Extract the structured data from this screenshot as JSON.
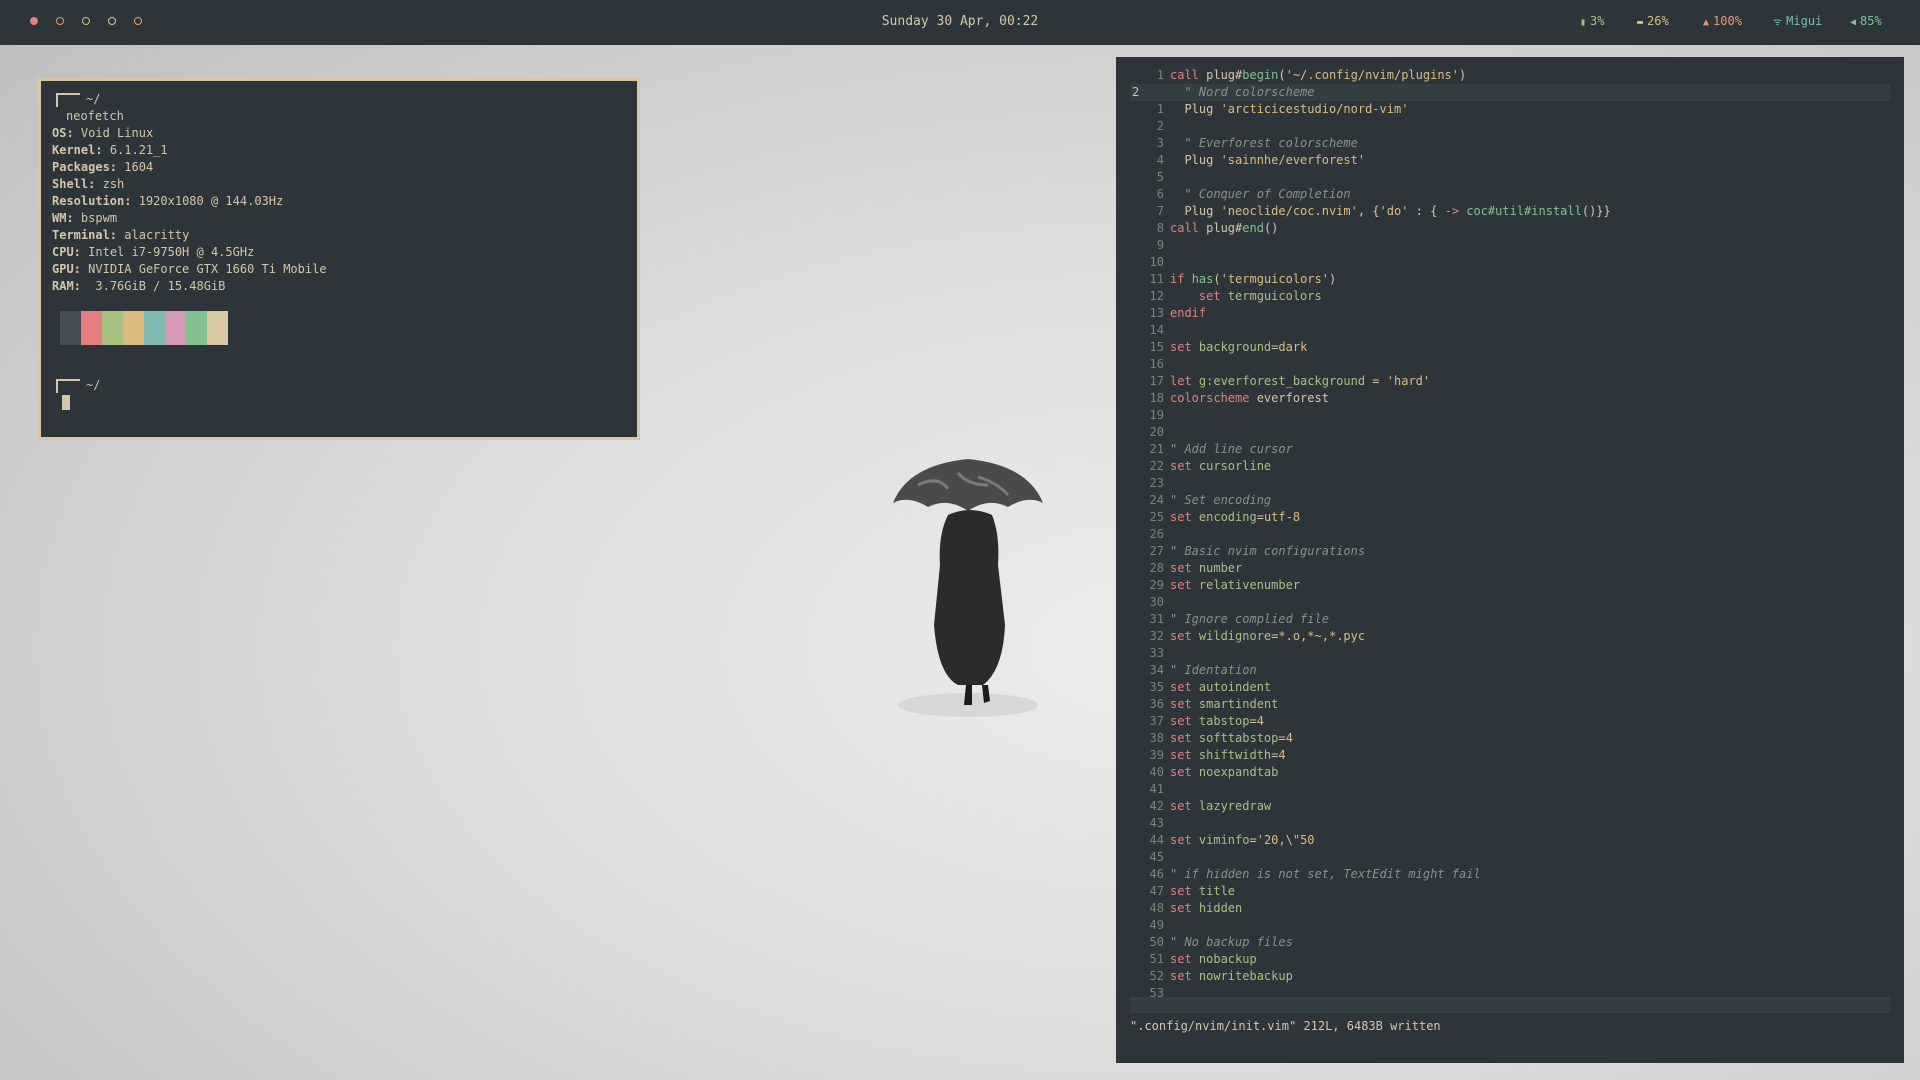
{
  "topbar": {
    "clock": "Sunday 30 Apr, 00:22",
    "cpu": "3%",
    "memory": "26%",
    "brightness": "100%",
    "network": "Migui",
    "volume": "85%"
  },
  "neofetch": {
    "prompt_dir": "~/",
    "command": "neofetch",
    "os_label": "OS:",
    "os_value": "Void Linux",
    "kernel_label": "Kernel:",
    "kernel_value": "6.1.21_1",
    "packages_label": "Packages:",
    "packages_value": "1604",
    "shell_label": "Shell:",
    "shell_value": "zsh",
    "resolution_label": "Resolution:",
    "resolution_value": "1920x1080 @ 144.03Hz",
    "wm_label": "WM:",
    "wm_value": "bspwm",
    "terminal_label": "Terminal:",
    "terminal_value": "alacritty",
    "cpu_label": "CPU:",
    "cpu_value": "Intel i7-9750H @ 4.5GHz",
    "gpu_label": "GPU:",
    "gpu_value": "NVIDIA GeForce GTX 1660 Ti Mobile",
    "ram_label": "RAM:",
    "ram_value": " 3.76GiB / 15.48GiB",
    "prompt_dir2": "~/",
    "palette": [
      "#434f55",
      "#e67e80",
      "#a7c080",
      "#dbbc7f",
      "#7fbbb3",
      "#d699b6",
      "#83c092",
      "#d9c9a3"
    ]
  },
  "nvim": {
    "lines": [
      {
        "n": "1",
        "t": [
          [
            "kw",
            "call "
          ],
          [
            "txt",
            "plug#"
          ],
          [
            "fn",
            "begin"
          ],
          [
            "txt",
            "("
          ],
          [
            "str",
            "'~/.config/nvim/plugins'"
          ],
          [
            "txt",
            ")"
          ]
        ]
      },
      {
        "n": "2",
        "t": [
          [
            "cmt",
            "  \" Nord colorscheme"
          ]
        ],
        "cur": true
      },
      {
        "n": "1",
        "t": [
          [
            "txt",
            "  Plug "
          ],
          [
            "str",
            "'arcticicestudio/nord-vim'"
          ]
        ]
      },
      {
        "n": "2",
        "t": []
      },
      {
        "n": "3",
        "t": [
          [
            "cmt",
            "  \" Everforest colorscheme"
          ]
        ]
      },
      {
        "n": "4",
        "t": [
          [
            "txt",
            "  Plug "
          ],
          [
            "str",
            "'sainnhe/everforest'"
          ]
        ]
      },
      {
        "n": "5",
        "t": []
      },
      {
        "n": "6",
        "t": [
          [
            "cmt",
            "  \" Conquer of Completion"
          ]
        ]
      },
      {
        "n": "7",
        "t": [
          [
            "txt",
            "  Plug "
          ],
          [
            "str",
            "'neoclide/coc.nvim'"
          ],
          [
            "txt",
            ", {"
          ],
          [
            "str",
            "'do'"
          ],
          [
            "txt",
            " : { "
          ],
          [
            "kw",
            "->"
          ],
          [
            "fn",
            " coc#util#install"
          ],
          [
            "txt",
            "()}}"
          ]
        ]
      },
      {
        "n": "8",
        "t": [
          [
            "kw",
            "call "
          ],
          [
            "txt",
            "plug#"
          ],
          [
            "fn",
            "end"
          ],
          [
            "txt",
            "()"
          ]
        ]
      },
      {
        "n": "9",
        "t": []
      },
      {
        "n": "10",
        "t": []
      },
      {
        "n": "11",
        "t": [
          [
            "kw",
            "if "
          ],
          [
            "fn",
            "has"
          ],
          [
            "txt",
            "("
          ],
          [
            "str",
            "'termguicolors'"
          ],
          [
            "txt",
            ")"
          ]
        ]
      },
      {
        "n": "12",
        "t": [
          [
            "kw",
            "    set "
          ],
          [
            "opt",
            "termguicolors"
          ]
        ]
      },
      {
        "n": "13",
        "t": [
          [
            "kw",
            "endif"
          ]
        ]
      },
      {
        "n": "14",
        "t": []
      },
      {
        "n": "15",
        "t": [
          [
            "kw",
            "set "
          ],
          [
            "opt",
            "background"
          ],
          [
            "txt",
            "="
          ],
          [
            "str",
            "dark"
          ]
        ]
      },
      {
        "n": "16",
        "t": []
      },
      {
        "n": "17",
        "t": [
          [
            "kw",
            "let "
          ],
          [
            "opt",
            "g:everforest_background"
          ],
          [
            "txt",
            " = "
          ],
          [
            "str",
            "'hard'"
          ]
        ]
      },
      {
        "n": "18",
        "t": [
          [
            "kw",
            "colorscheme "
          ],
          [
            "txt",
            "everforest"
          ]
        ]
      },
      {
        "n": "19",
        "t": []
      },
      {
        "n": "20",
        "t": []
      },
      {
        "n": "21",
        "t": [
          [
            "cmt",
            "\" Add line cursor"
          ]
        ]
      },
      {
        "n": "22",
        "t": [
          [
            "kw",
            "set "
          ],
          [
            "opt",
            "cursorline"
          ]
        ]
      },
      {
        "n": "23",
        "t": []
      },
      {
        "n": "24",
        "t": [
          [
            "cmt",
            "\" Set encoding"
          ]
        ]
      },
      {
        "n": "25",
        "t": [
          [
            "kw",
            "set "
          ],
          [
            "opt",
            "encoding"
          ],
          [
            "txt",
            "="
          ],
          [
            "str",
            "utf-8"
          ]
        ]
      },
      {
        "n": "26",
        "t": []
      },
      {
        "n": "27",
        "t": [
          [
            "cmt",
            "\" Basic nvim configurations"
          ]
        ]
      },
      {
        "n": "28",
        "t": [
          [
            "kw",
            "set "
          ],
          [
            "opt",
            "number"
          ]
        ]
      },
      {
        "n": "29",
        "t": [
          [
            "kw",
            "set "
          ],
          [
            "opt",
            "relativenumber"
          ]
        ]
      },
      {
        "n": "30",
        "t": []
      },
      {
        "n": "31",
        "t": [
          [
            "cmt",
            "\" Ignore complied file"
          ]
        ]
      },
      {
        "n": "32",
        "t": [
          [
            "kw",
            "set "
          ],
          [
            "opt",
            "wildignore"
          ],
          [
            "txt",
            "="
          ],
          [
            "str",
            "*.o,*~,*.pyc"
          ]
        ]
      },
      {
        "n": "33",
        "t": []
      },
      {
        "n": "34",
        "t": [
          [
            "cmt",
            "\" Identation"
          ]
        ]
      },
      {
        "n": "35",
        "t": [
          [
            "kw",
            "set "
          ],
          [
            "opt",
            "autoindent"
          ]
        ]
      },
      {
        "n": "36",
        "t": [
          [
            "kw",
            "set "
          ],
          [
            "opt",
            "smartindent"
          ]
        ]
      },
      {
        "n": "37",
        "t": [
          [
            "kw",
            "set "
          ],
          [
            "opt",
            "tabstop"
          ],
          [
            "txt",
            "="
          ],
          [
            "str",
            "4"
          ]
        ]
      },
      {
        "n": "38",
        "t": [
          [
            "kw",
            "set "
          ],
          [
            "opt",
            "softtabstop"
          ],
          [
            "txt",
            "="
          ],
          [
            "str",
            "4"
          ]
        ]
      },
      {
        "n": "39",
        "t": [
          [
            "kw",
            "set "
          ],
          [
            "opt",
            "shiftwidth"
          ],
          [
            "txt",
            "="
          ],
          [
            "str",
            "4"
          ]
        ]
      },
      {
        "n": "40",
        "t": [
          [
            "kw",
            "set "
          ],
          [
            "opt",
            "noexpandtab"
          ]
        ]
      },
      {
        "n": "41",
        "t": []
      },
      {
        "n": "42",
        "t": [
          [
            "kw",
            "set "
          ],
          [
            "opt",
            "lazyredraw"
          ]
        ]
      },
      {
        "n": "43",
        "t": []
      },
      {
        "n": "44",
        "t": [
          [
            "kw",
            "set "
          ],
          [
            "opt",
            "viminfo"
          ],
          [
            "txt",
            "="
          ],
          [
            "str",
            "'20,\\\"50"
          ]
        ]
      },
      {
        "n": "45",
        "t": []
      },
      {
        "n": "46",
        "t": [
          [
            "cmt",
            "\" if hidden is not set, TextEdit might fail"
          ]
        ]
      },
      {
        "n": "47",
        "t": [
          [
            "kw",
            "set "
          ],
          [
            "opt",
            "title"
          ]
        ]
      },
      {
        "n": "48",
        "t": [
          [
            "kw",
            "set "
          ],
          [
            "opt",
            "hidden"
          ]
        ]
      },
      {
        "n": "49",
        "t": []
      },
      {
        "n": "50",
        "t": [
          [
            "cmt",
            "\" No backup files"
          ]
        ]
      },
      {
        "n": "51",
        "t": [
          [
            "kw",
            "set "
          ],
          [
            "opt",
            "nobackup"
          ]
        ]
      },
      {
        "n": "52",
        "t": [
          [
            "kw",
            "set "
          ],
          [
            "opt",
            "nowritebackup"
          ]
        ]
      },
      {
        "n": "53",
        "t": []
      }
    ],
    "message": "\".config/nvim/init.vim\" 212L, 6483B written"
  }
}
